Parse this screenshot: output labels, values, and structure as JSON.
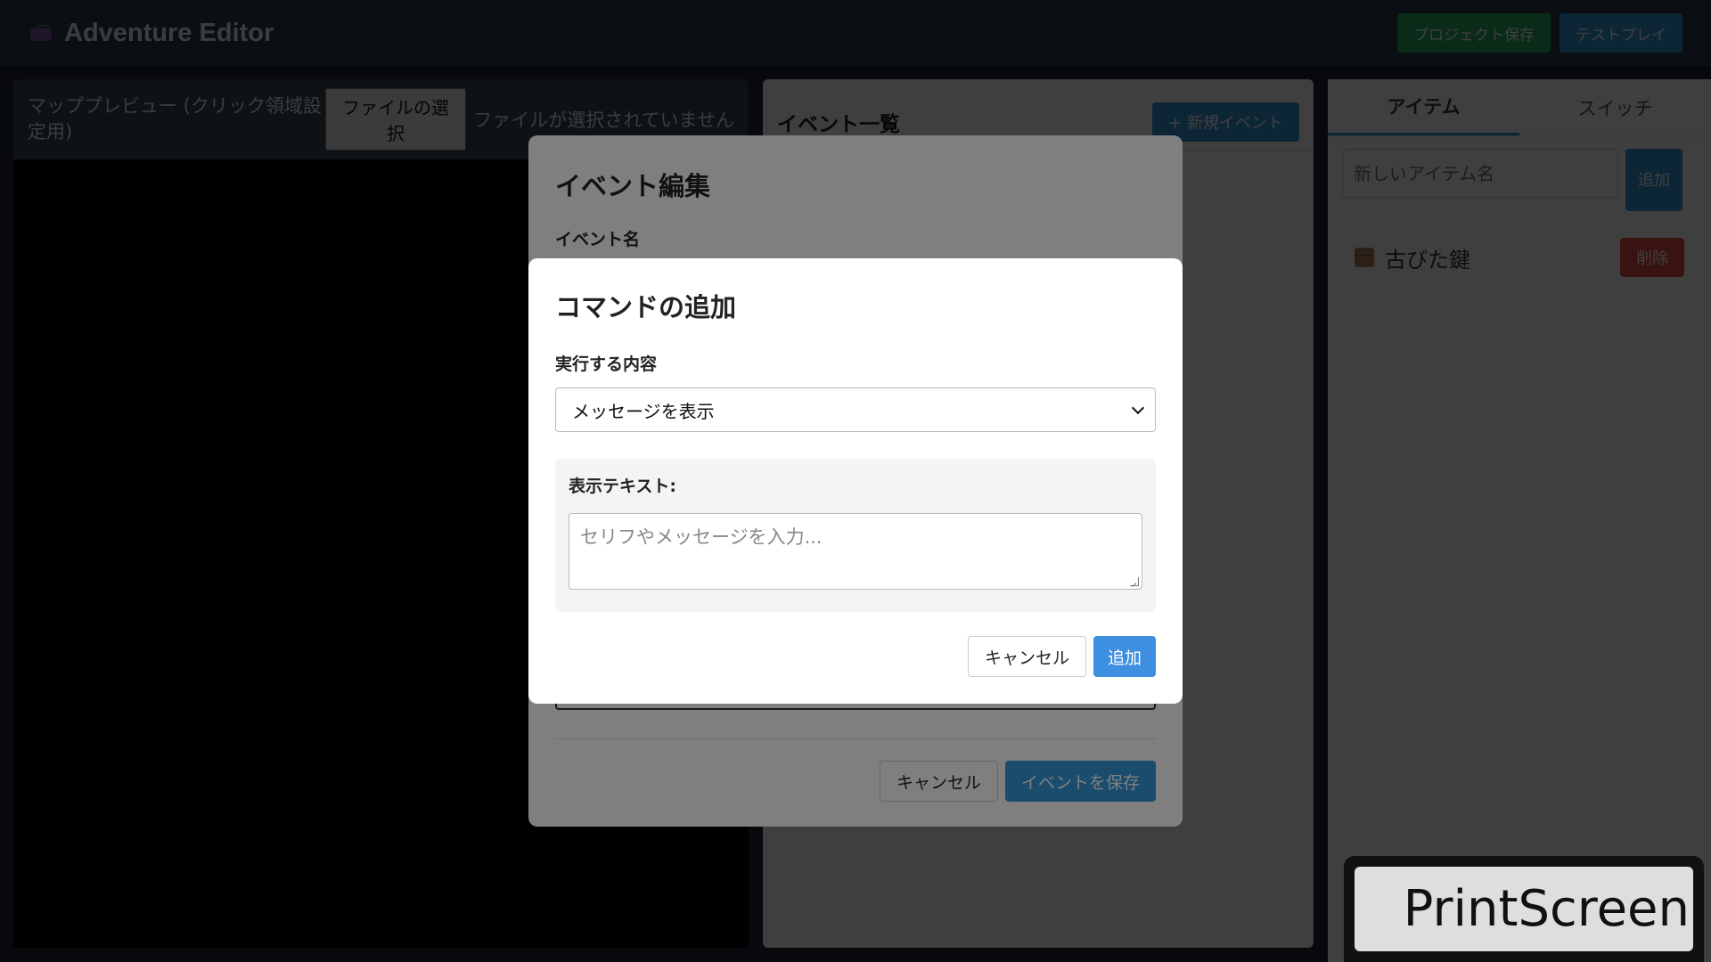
{
  "header": {
    "title": "Adventure Editor",
    "save_label": "プロジェクト保存",
    "play_label": "テストプレイ"
  },
  "map": {
    "title": "マッププレビュー (クリック領域設定用)",
    "file_button": "ファイルの選択",
    "file_status": "ファイルが選択されていません"
  },
  "events": {
    "title": "イベント一覧",
    "new_button": "+ 新規イベント"
  },
  "sidebar": {
    "tabs": [
      "アイテム",
      "スイッチ"
    ],
    "item_placeholder": "新しいアイテム名",
    "add_label": "追加",
    "items": [
      {
        "name": "古びた鍵",
        "icon": "box-icon",
        "delete_label": "削除"
      }
    ]
  },
  "edit_modal": {
    "title": "イベント編集",
    "name_label": "イベント名",
    "cancel_label": "キャンセル",
    "save_label": "イベントを保存"
  },
  "command_modal": {
    "title": "コマンドの追加",
    "action_label": "実行する内容",
    "action_value": "メッセージを表示",
    "text_label": "表示テキスト:",
    "text_placeholder": "セリフやメッセージを入力...",
    "cancel_label": "キャンセル",
    "add_label": "追加"
  },
  "overlay_key": {
    "label": "PrintScreen"
  },
  "colors": {
    "header_bg": "#2c3e50",
    "primary": "#3498db",
    "success": "#27ae60",
    "danger": "#e74c3c"
  }
}
